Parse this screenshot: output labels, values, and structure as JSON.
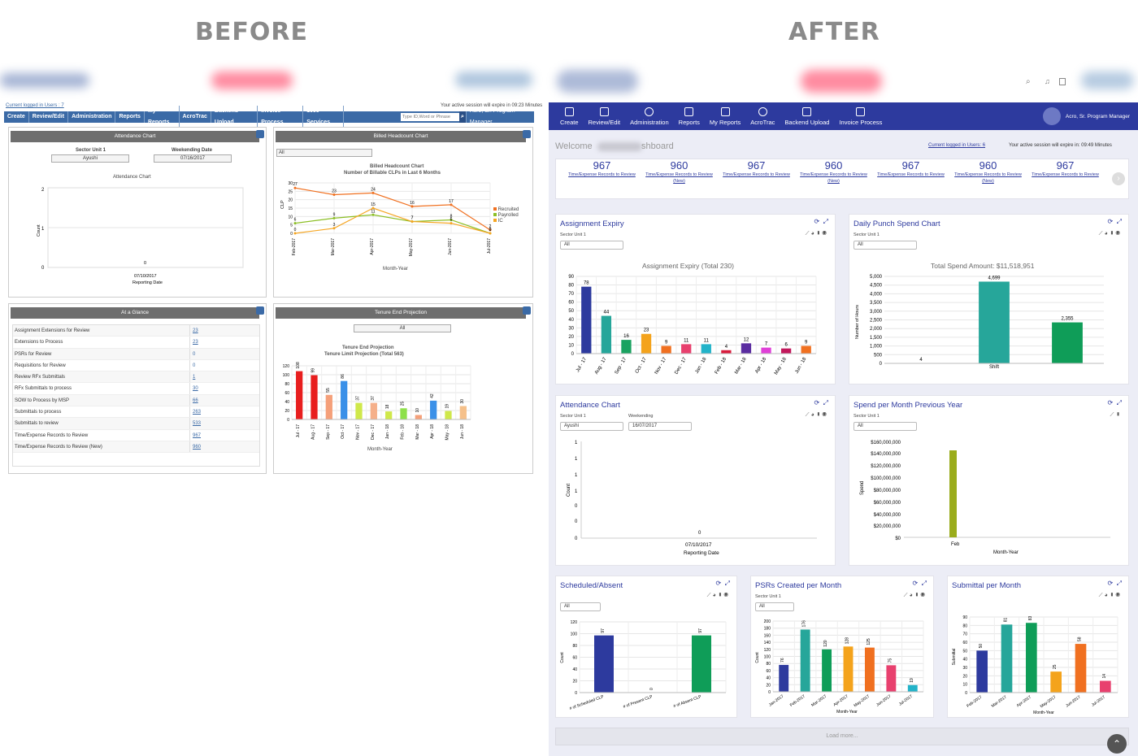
{
  "labels": {
    "before": "BEFORE",
    "after": "AFTER"
  },
  "before": {
    "current_users": "Current logged in Users : 7",
    "session": "Your active session will expire in 09:23 Minutes",
    "nav": [
      "Create",
      "Review/Edit",
      "Administration",
      "Reports",
      "My Reports",
      "AcroTrac",
      "Backend Upload",
      "Invoice Process",
      "1099 Services"
    ],
    "search_placeholder": "Type ID,Word or Phrase",
    "user": "Acro, Sr. Program Manager",
    "attendance": {
      "header": "Attendance Chart",
      "sector_label": "Sector Unit 1",
      "sector_value": "Ayushi",
      "week_label": "Weekending Date",
      "week_value": "07/16/2017",
      "chart_title": "Attendance Chart",
      "ylabel": "Count",
      "xdate": "07/10/2017",
      "xlabel": "Reporting Date",
      "yticks": [
        "2",
        "1",
        "0"
      ],
      "point_label": "0"
    },
    "billed": {
      "header": "Billed Headcount Chart",
      "filter": "All",
      "title1": "Billed Headcount Chart",
      "title2": "Number of Billable CLPs in Last 6 Months",
      "ylabel": "CLP",
      "xlabel": "Month-Year",
      "legend": [
        "Recruited",
        "Payrolled",
        "IC"
      ]
    },
    "glance": {
      "header": "At a Glance",
      "rows": [
        {
          "label": "Assignment Extensions for Review",
          "value": "23"
        },
        {
          "label": "Extensions to Process",
          "value": "23"
        },
        {
          "label": "PSRs for Review",
          "value": "0"
        },
        {
          "label": "Requisitions for Review",
          "value": "0"
        },
        {
          "label": "Review RFx Submittals",
          "value": "1"
        },
        {
          "label": "RFx Submittals to process",
          "value": "30"
        },
        {
          "label": "SOW to Process by MSP",
          "value": "66"
        },
        {
          "label": "Submittals to process",
          "value": "263"
        },
        {
          "label": "Submittals to review",
          "value": "533"
        },
        {
          "label": "Time/Expense Records to Review",
          "value": "967"
        },
        {
          "label": "Time/Expense Records to Review (New)",
          "value": "960"
        }
      ]
    },
    "tenure": {
      "header": "Tenure End Projection",
      "filter": "All",
      "title1": "Tenure End Projection",
      "title2": "Tenure Limit Projection (Total 563)",
      "xlabel": "Month-Year"
    }
  },
  "after": {
    "nav": [
      "Create",
      "Review/Edit",
      "Administration",
      "Reports",
      "My Reports",
      "AcroTrac",
      "Backend Upload",
      "Invoice Process"
    ],
    "user": "Acro, Sr. Program Manager",
    "welcome_prefix": "Welcome",
    "welcome_suffix": "shboard",
    "current_users": "Current logged in Users: 6",
    "session": "Your active session will expire in: 09:49 Minutes",
    "kpis": [
      {
        "value": "967",
        "label": "Time/Expense Records to Review"
      },
      {
        "value": "960",
        "label": "Time/Expense Records to Review (New)"
      },
      {
        "value": "967",
        "label": "Time/Expense Records to Review"
      },
      {
        "value": "960",
        "label": "Time/Expense Records to Review (New)"
      },
      {
        "value": "967",
        "label": "Time/Expense Records to Review"
      },
      {
        "value": "960",
        "label": "Time/Expense Records to Review (New)"
      },
      {
        "value": "967",
        "label": "Time/Expense Records to Review"
      }
    ],
    "cards": {
      "assignment": {
        "title": "Assignment Expiry",
        "sector_label": "Sector Unit 1",
        "filter": "All",
        "chart_title": "Assignment Expiry (Total 230)"
      },
      "spend": {
        "title": "Daily Punch Spend Chart",
        "sector_label": "Sector Unit 1",
        "filter": "All",
        "chart_title": "Total Spend Amount: $11,518,951",
        "ylabel": "Number of Hours",
        "xlabel": "Shift"
      },
      "attendance": {
        "title": "Attendance Chart",
        "sector_label": "Sector Unit 1",
        "sector_value": "Ayushi",
        "week_label": "Weekending",
        "week_value": "16/07/2017",
        "ylabel": "Count",
        "xdate": "07/10/2017",
        "xlabel": "Reporting Date",
        "point_label": "0"
      },
      "spend_month": {
        "title": "Spend per Month Previous Year",
        "sector_label": "Sector Unit 1",
        "filter": "All",
        "ylabel": "Spend",
        "xlabel": "Month-Year",
        "xcat": "Feb"
      },
      "scheduled": {
        "title": "Scheduled/Absent",
        "filter": "All",
        "ylabel": "Count"
      },
      "psrs": {
        "title": "PSRs Created per Month",
        "sector_label": "Sector Unit 1",
        "filter": "All",
        "ylabel": "Count",
        "xlabel": "Month-Year"
      },
      "submittal": {
        "title": "Submittal per Month",
        "ylabel": "Submittal",
        "xlabel": "Month-Year"
      }
    },
    "load_more": "Load more..."
  },
  "chart_data": [
    {
      "type": "line",
      "title": "Billed Headcount Chart",
      "categories": [
        "Feb-2017",
        "Mar-2017",
        "Apr-2017",
        "May-2017",
        "Jun-2017",
        "Jul-2017"
      ],
      "ylim": [
        0,
        30
      ],
      "series": [
        {
          "name": "Recruited",
          "values": [
            27,
            23,
            24,
            16,
            17,
            2
          ],
          "color": "#f07020"
        },
        {
          "name": "Payrolled",
          "values": [
            6,
            9,
            11,
            7,
            8,
            0
          ],
          "color": "#8cbf26"
        },
        {
          "name": "IC",
          "values": [
            0,
            3,
            15,
            7,
            6,
            0
          ],
          "color": "#f5a623"
        }
      ]
    },
    {
      "type": "bar",
      "title": "Tenure Limit Projection (Total 563)",
      "categories": [
        "Jul - 17",
        "Aug - 17",
        "Sep - 17",
        "Oct - 17",
        "Nov - 17",
        "Dec - 17",
        "Jan - 18",
        "Feb - 18",
        "Mar - 18",
        "Apr - 18",
        "May - 18",
        "Jun - 18"
      ],
      "values": [
        108,
        99,
        55,
        86,
        37,
        37,
        18,
        25,
        10,
        42,
        19,
        30
      ],
      "ylim": [
        0,
        120
      ],
      "colors": [
        "#e81e1e",
        "#e81e1e",
        "#f5a07a",
        "#3a90e8",
        "#cfe84a",
        "#f5b08a",
        "#cfe84a",
        "#8ee04a",
        "#f5a07a",
        "#3a90e8",
        "#cfe84a",
        "#f5c08a"
      ]
    },
    {
      "type": "bar",
      "title": "Assignment Expiry (Total 230)",
      "categories": [
        "Jul - 17",
        "Aug - 17",
        "Sep - 17",
        "Oct - 17",
        "Nov - 17",
        "Dec - 17",
        "Jan - 18",
        "Feb - 18",
        "Mar - 18",
        "Apr - 18",
        "May - 18",
        "Jun - 18"
      ],
      "values": [
        78,
        44,
        16,
        23,
        9,
        11,
        11,
        4,
        12,
        7,
        6,
        9
      ],
      "ylim": [
        0,
        90
      ],
      "colors": [
        "#2d3a9e",
        "#26a69a",
        "#1aa260",
        "#f4a31c",
        "#f07020",
        "#e8406e",
        "#22b3c9",
        "#d81b3c",
        "#5a2ca0",
        "#e040d8",
        "#c2185b",
        "#f07020"
      ]
    },
    {
      "type": "bar",
      "title": "Total Spend Amount: $11,518,951",
      "categories": [
        "",
        "Shift",
        ""
      ],
      "values": [
        4,
        4699,
        2355
      ],
      "ylim": [
        0,
        5000
      ],
      "colors": [
        "#2d3a9e",
        "#26a69a",
        "#0f9d58"
      ]
    },
    {
      "type": "bar",
      "title": "Scheduled/Absent",
      "categories": [
        "# of Scheduled CLP",
        "# of Present CLP",
        "# of Absent CLP"
      ],
      "values": [
        97,
        0,
        97
      ],
      "ylim": [
        0,
        120
      ],
      "colors": [
        "#2d3a9e",
        "#26a69a",
        "#0f9d58"
      ]
    },
    {
      "type": "bar",
      "title": "PSRs Created per Month",
      "categories": [
        "Jan-2017",
        "Feb-2017",
        "Mar-2017",
        "Apr-2017",
        "May-2017",
        "Jun-2017",
        "Jul-2017"
      ],
      "values": [
        76,
        176,
        120,
        128,
        125,
        75,
        19
      ],
      "ylim": [
        0,
        200
      ],
      "colors": [
        "#2d3a9e",
        "#26a69a",
        "#0f9d58",
        "#f4a31c",
        "#f07020",
        "#e8406e",
        "#22b3c9"
      ]
    },
    {
      "type": "bar",
      "title": "Submittal per Month",
      "categories": [
        "Feb-2017",
        "Mar-2017",
        "Apr-2017",
        "May-2017",
        "Jun-2017",
        "Jul-2017"
      ],
      "values": [
        50,
        81,
        83,
        25,
        58,
        14
      ],
      "ylim": [
        0,
        90
      ],
      "colors": [
        "#2d3a9e",
        "#26a69a",
        "#0f9d58",
        "#f4a31c",
        "#f07020",
        "#e8406e"
      ]
    }
  ]
}
